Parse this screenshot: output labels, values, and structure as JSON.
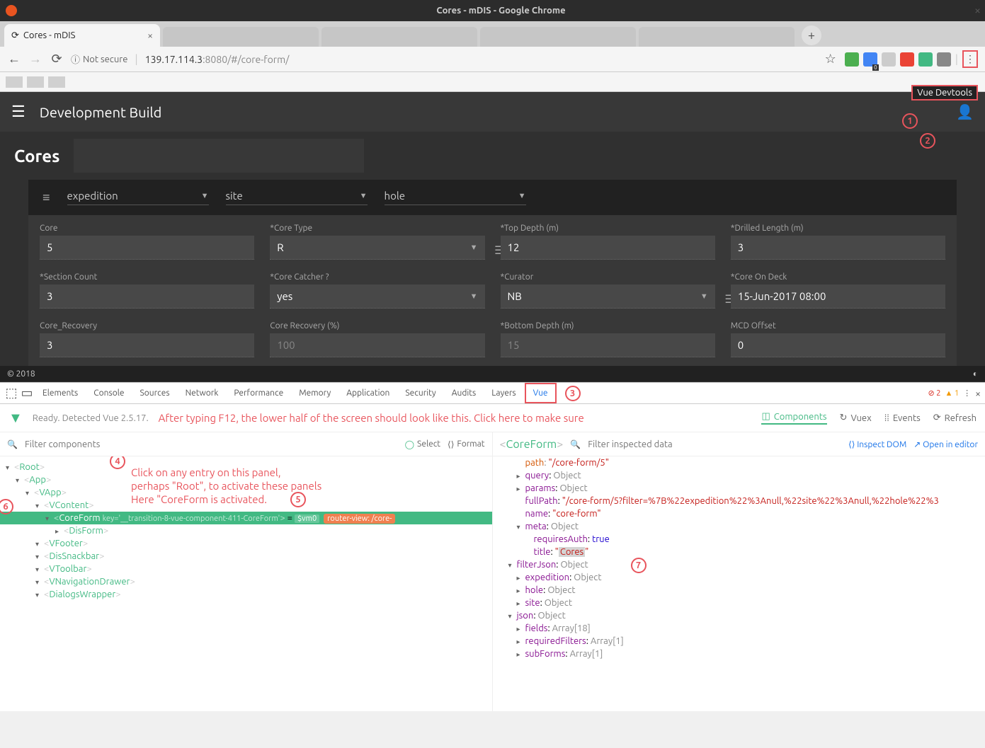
{
  "window": {
    "title": "Cores - mDIS - Google Chrome"
  },
  "tabs": {
    "active": {
      "title": "Cores - mDIS"
    }
  },
  "address": {
    "not_secure": "Not secure",
    "host": "139.17.114.3",
    "rest": ":8080/#/core-form/"
  },
  "tooltip": "Vue Devtools",
  "app": {
    "header_title": "Development Build",
    "page_title": "Cores",
    "filters": {
      "expedition": "expedition",
      "site": "site",
      "hole": "hole"
    },
    "fields": {
      "core": {
        "label": "Core",
        "value": "5"
      },
      "core_type": {
        "label": "*Core Type",
        "value": "R"
      },
      "top_depth": {
        "label": "*Top Depth (m)",
        "value": "12"
      },
      "drilled_length": {
        "label": "*Drilled Length (m)",
        "value": "3"
      },
      "section_count": {
        "label": "*Section Count",
        "value": "3"
      },
      "core_catcher": {
        "label": "*Core Catcher ?",
        "value": "yes"
      },
      "curator": {
        "label": "*Curator",
        "value": "NB"
      },
      "core_on_deck": {
        "label": "*Core On Deck",
        "value": "15-Jun-2017 08:00"
      },
      "core_recovery": {
        "label": "Core_Recovery",
        "value": "3"
      },
      "core_recovery_pct": {
        "label": "Core Recovery (%)",
        "value": "100"
      },
      "bottom_depth": {
        "label": "*Bottom Depth (m)",
        "value": "15"
      },
      "mcd_offset": {
        "label": "MCD Offset",
        "value": "0"
      }
    },
    "footer": "© 2018"
  },
  "devtools": {
    "tabs": [
      "Elements",
      "Console",
      "Sources",
      "Network",
      "Performance",
      "Memory",
      "Application",
      "Security",
      "Audits",
      "Layers",
      "Vue"
    ],
    "active_tab": "Vue",
    "errors": "2",
    "warnings": "1",
    "vue": {
      "status": "Ready. Detected Vue 2.5.17.",
      "instruction": "After typing F12, the lower half of the screen should look like this. Click here to make sure",
      "nav": {
        "components": "Components",
        "vuex": "Vuex",
        "events": "Events",
        "refresh": "Refresh"
      },
      "filter_placeholder": "Filter components",
      "select": "Select",
      "format": "Format",
      "tree": [
        {
          "name": "Root",
          "depth": 0
        },
        {
          "name": "App",
          "depth": 1
        },
        {
          "name": "VApp",
          "depth": 2
        },
        {
          "name": "VContent",
          "depth": 3
        },
        {
          "name": "CoreForm",
          "depth": 4,
          "selected": true,
          "key": "key='__transition-8-vue-component-411-CoreForm'",
          "vm": "$vm0",
          "route": "router-view: /core-"
        },
        {
          "name": "DisForm",
          "depth": 5
        },
        {
          "name": "VFooter",
          "depth": 3
        },
        {
          "name": "DisSnackbar",
          "depth": 3
        },
        {
          "name": "VToolbar",
          "depth": 3
        },
        {
          "name": "VNavigationDrawer",
          "depth": 3
        },
        {
          "name": "DialogsWrapper",
          "depth": 3
        }
      ],
      "inspect": {
        "title": "CoreForm",
        "filter_placeholder": "Filter inspected data",
        "inspect_dom": "Inspect DOM",
        "open_editor": "Open in editor",
        "props": {
          "path": "/core-form/5",
          "query": "Object",
          "params": "Object",
          "fullPath": "/core-form/5?filter=%7B%22expedition%22%3Anull,%22site%22%3Anull,%22hole%22%3",
          "name": "core-form",
          "meta": "Object",
          "requiresAuth": "true",
          "title": "Cores",
          "filterJson": "Object",
          "expedition": "Object",
          "hole": "Object",
          "site": "Object",
          "json": "Object",
          "fields": "Array[18]",
          "requiredFilters": "Array[1]",
          "subForms": "Array[1]"
        }
      }
    }
  },
  "annotations": {
    "a1": "1",
    "a2": "2",
    "a3": "3",
    "a4": "4",
    "a5": "5",
    "a6": "6",
    "a7": "7",
    "tree_text1": "Click on any entry on this panel,",
    "tree_text2": "perhaps \"Root\", to activate these panels",
    "tree_text3": "Here \"CoreForm is activated."
  }
}
